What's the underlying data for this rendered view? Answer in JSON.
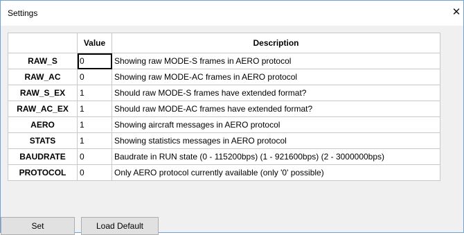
{
  "window": {
    "title": "Settings",
    "close_glyph": "✕"
  },
  "table": {
    "headers": {
      "value": "Value",
      "description": "Description"
    },
    "rows": [
      {
        "name": "RAW_S",
        "value": "0",
        "description": "Showing raw MODE-S frames in AERO protocol"
      },
      {
        "name": "RAW_AC",
        "value": "0",
        "description": "Showing raw MODE-AC frames in AERO protocol"
      },
      {
        "name": "RAW_S_EX",
        "value": "1",
        "description": "Should raw MODE-S frames have extended format?"
      },
      {
        "name": "RAW_AC_EX",
        "value": "1",
        "description": "Should raw MODE-AC frames have extended format?"
      },
      {
        "name": "AERO",
        "value": "1",
        "description": "Showing aircraft messages in AERO protocol"
      },
      {
        "name": "STATS",
        "value": "1",
        "description": "Showing statistics messages in AERO protocol"
      },
      {
        "name": "BAUDRATE",
        "value": "0",
        "description": "Baudrate in RUN state (0 - 115200bps) (1 - 921600bps) (2 - 3000000bps)"
      },
      {
        "name": "PROTOCOL",
        "value": "0",
        "description": "Only AERO protocol currently available (only '0' possible)"
      }
    ]
  },
  "buttons": {
    "set": "Set",
    "load_default": "Load Default"
  },
  "colors": {
    "window_border": "#6f9fd8",
    "client_bg": "#f0f0f0",
    "grid_line": "#c8c8c8",
    "button_bg": "#e1e1e1"
  }
}
